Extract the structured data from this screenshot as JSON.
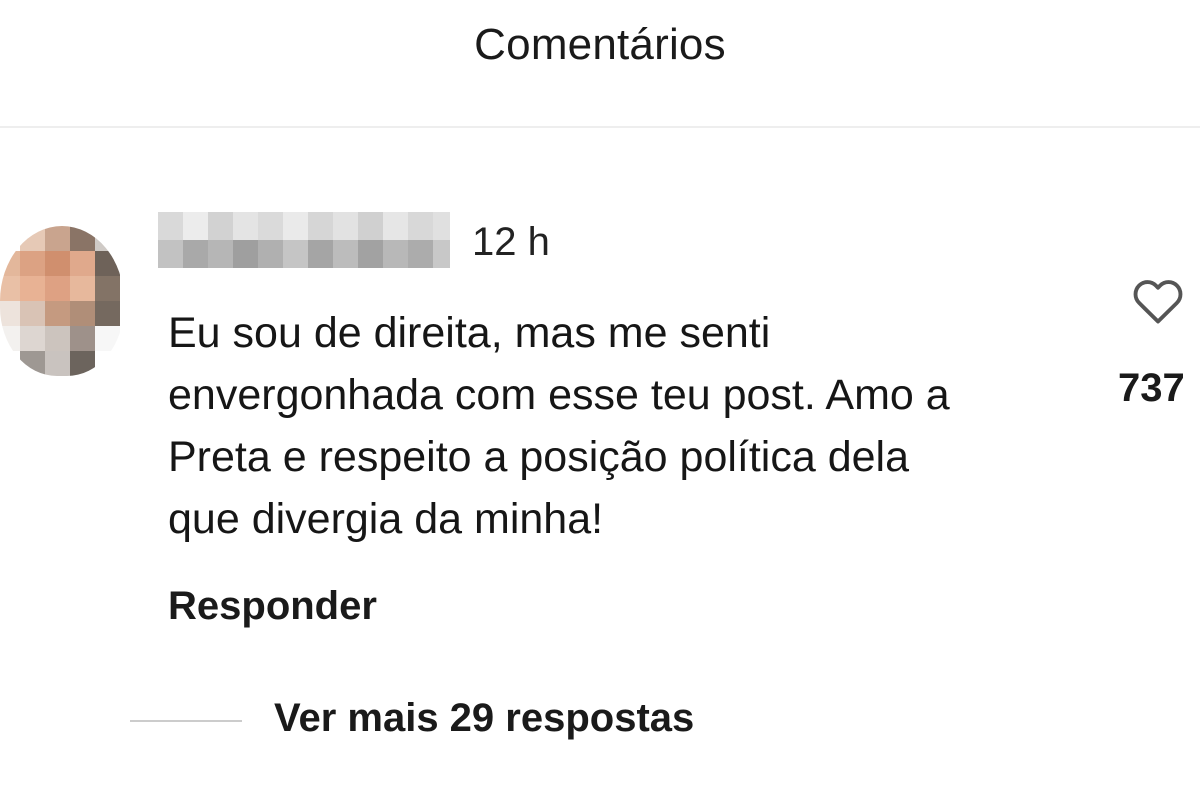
{
  "header": {
    "title": "Comentários"
  },
  "comment": {
    "timestamp": "12 h",
    "text_lines": [
      "Eu sou de direita, mas me senti",
      "envergonhada com esse teu post. Amo a",
      "Preta e respeito a posição política dela",
      "que divergia da minha!"
    ],
    "reply_label": "Responder",
    "like_icon": "heart-outline-icon",
    "like_count": "737",
    "avatar_icon": "pixelated-avatar",
    "username_icon": "pixelated-username"
  },
  "replies": {
    "more_label": "Ver mais 29 respostas"
  }
}
